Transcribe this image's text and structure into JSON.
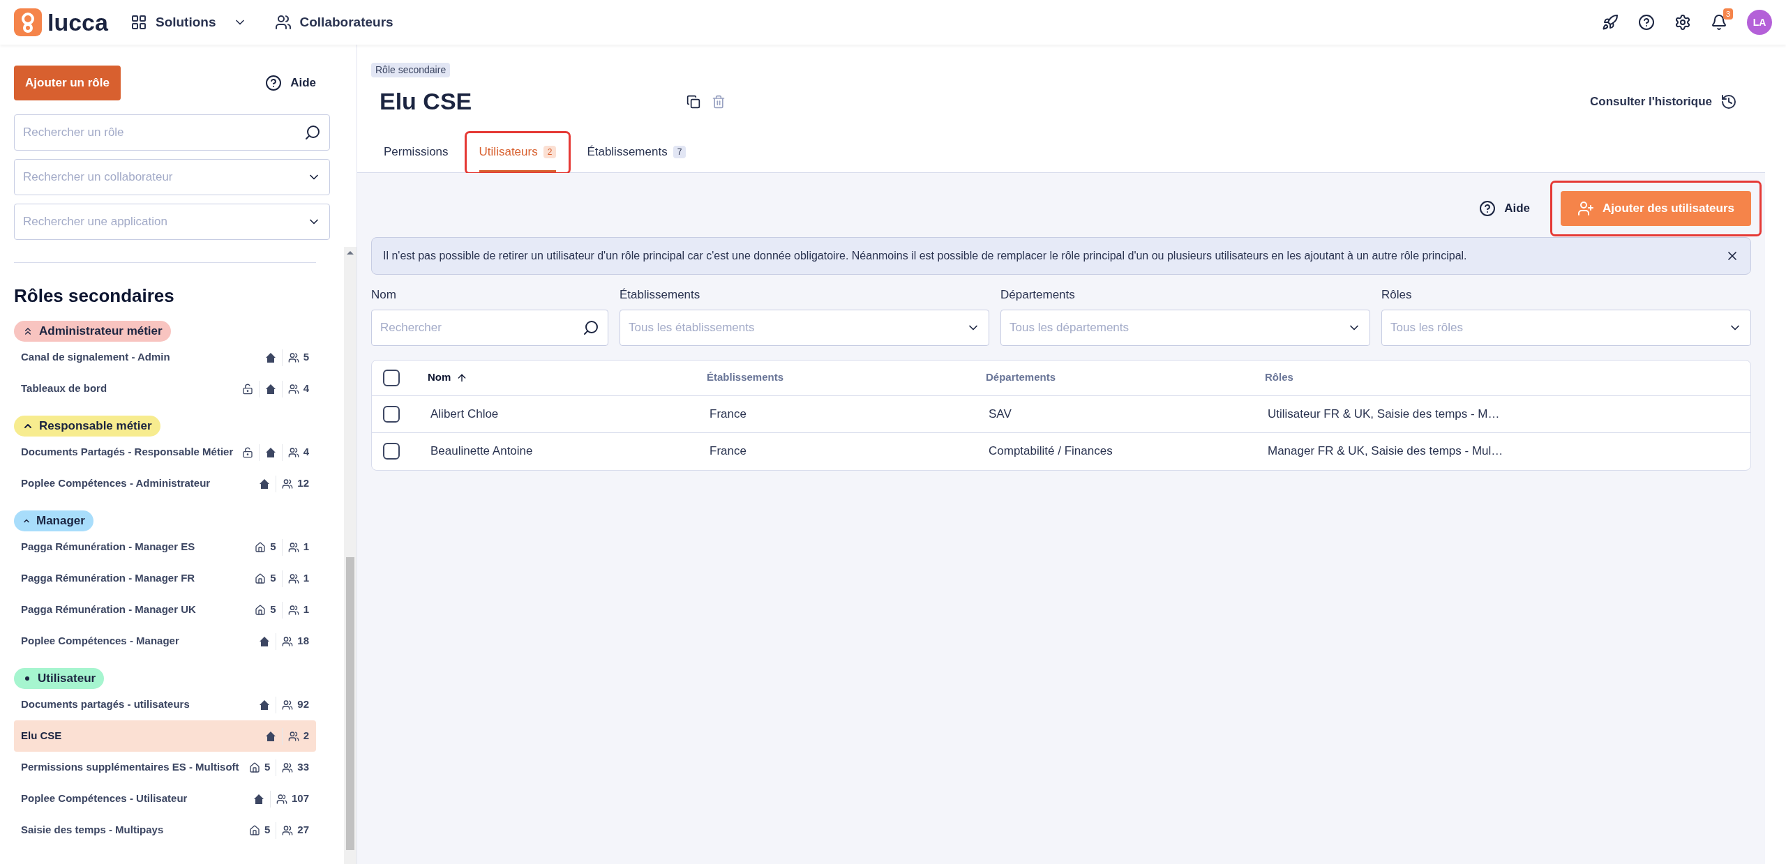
{
  "topbar": {
    "logo": "lucca",
    "nav": [
      {
        "label": "Solutions",
        "kind": "apps"
      },
      {
        "label": "Collaborateurs",
        "kind": "people"
      }
    ],
    "notifications": "3",
    "avatar": "LA"
  },
  "sidebar": {
    "add_button": "Ajouter un rôle",
    "help": "Aide",
    "search": {
      "placeholder": "Rechercher un rôle"
    },
    "filters": [
      {
        "placeholder": "Rechercher un collaborateur"
      },
      {
        "placeholder": "Rechercher une application"
      }
    ],
    "heading": "Rôles secondaires",
    "groups": [
      {
        "label": "Administrateur métier",
        "kind": "double",
        "color": "#f8c4c0",
        "items": [
          {
            "name": "Canal de signalement - Admin",
            "locked": false,
            "all_sites": true,
            "users": "5",
            "selected": false
          },
          {
            "name": "Tableaux de bord",
            "locked": true,
            "all_sites": true,
            "users": "4",
            "selected": false
          }
        ]
      },
      {
        "label": "Responsable métier",
        "kind": "single",
        "color": "#f7ec8f",
        "items": [
          {
            "name": "Documents Partagés - Responsable Métier",
            "locked": true,
            "all_sites": true,
            "users": "4",
            "selected": false
          },
          {
            "name": "Poplee Compétences - Administrateur",
            "locked": false,
            "all_sites": true,
            "users": "12",
            "selected": false
          }
        ]
      },
      {
        "label": "Manager",
        "kind": "caret",
        "color": "#a8ddfb",
        "items": [
          {
            "name": "Pagga Rémunération - Manager ES",
            "locked": false,
            "all_sites": false,
            "sites": "5",
            "users": "1",
            "selected": false
          },
          {
            "name": "Pagga Rémunération - Manager FR",
            "locked": false,
            "all_sites": false,
            "sites": "5",
            "users": "1",
            "selected": false
          },
          {
            "name": "Pagga Rémunération - Manager UK",
            "locked": false,
            "all_sites": false,
            "sites": "5",
            "users": "1",
            "selected": false
          },
          {
            "name": "Poplee Compétences - Manager",
            "locked": false,
            "all_sites": true,
            "users": "18",
            "selected": false
          }
        ]
      },
      {
        "label": "Utilisateur",
        "kind": "dot",
        "color": "#a6f5cf",
        "items": [
          {
            "name": "Documents partagés - utilisateurs",
            "locked": false,
            "all_sites": true,
            "users": "92",
            "selected": false
          },
          {
            "name": "Elu CSE",
            "locked": false,
            "all_sites": true,
            "users": "2",
            "selected": true
          },
          {
            "name": "Permissions supplémentaires ES - Multisoft",
            "locked": false,
            "all_sites": false,
            "sites": "5",
            "users": "33",
            "selected": false
          },
          {
            "name": "Poplee Compétences - Utilisateur",
            "locked": false,
            "all_sites": true,
            "users": "107",
            "selected": false
          },
          {
            "name": "Saisie des temps - Multipays",
            "locked": false,
            "all_sites": false,
            "sites": "5",
            "users": "27",
            "selected": false
          }
        ]
      }
    ]
  },
  "main": {
    "badge": "Rôle secondaire",
    "title": "Elu CSE",
    "history": "Consulter l'historique",
    "tabs": [
      {
        "label": "Permissions",
        "selected": false,
        "highlighted": false
      },
      {
        "label": "Utilisateurs",
        "count": "2",
        "selected": true,
        "highlighted": true
      },
      {
        "label": "Établissements",
        "count": "7",
        "selected": false,
        "highlighted": false
      }
    ],
    "help": "Aide",
    "add_users": {
      "label": "Ajouter des utilisateurs",
      "highlighted": true
    },
    "alert": "Il n'est pas possible de retirer un utilisateur d'un rôle principal car c'est une donnée obligatoire. Néanmoins il est possible de remplacer le rôle principal d'un ou plusieurs utilisateurs en les ajoutant à un autre rôle principal.",
    "filters": [
      {
        "label": "Nom",
        "kind": "search",
        "placeholder": "Rechercher"
      },
      {
        "label": "Établissements",
        "kind": "select",
        "placeholder": "Tous les établissements"
      },
      {
        "label": "Départements",
        "kind": "select",
        "placeholder": "Tous les départements"
      },
      {
        "label": "Rôles",
        "kind": "select",
        "placeholder": "Tous les rôles"
      }
    ],
    "table": {
      "all_checked": false,
      "columns": [
        {
          "label": "Nom",
          "sorted": true
        },
        {
          "label": "Établissements",
          "sorted": false
        },
        {
          "label": "Départements",
          "sorted": false
        },
        {
          "label": "Rôles",
          "sorted": false
        }
      ],
      "rows": [
        {
          "checked": false,
          "cells": [
            "Alibert Chloe",
            "France",
            "SAV",
            "Utilisateur FR & UK, Saisie des temps - M…"
          ]
        },
        {
          "checked": false,
          "cells": [
            "Beaulinette Antoine",
            "France",
            "Comptabilité / Finances",
            "Manager FR & UK, Saisie des temps - Mul…"
          ]
        }
      ]
    }
  }
}
